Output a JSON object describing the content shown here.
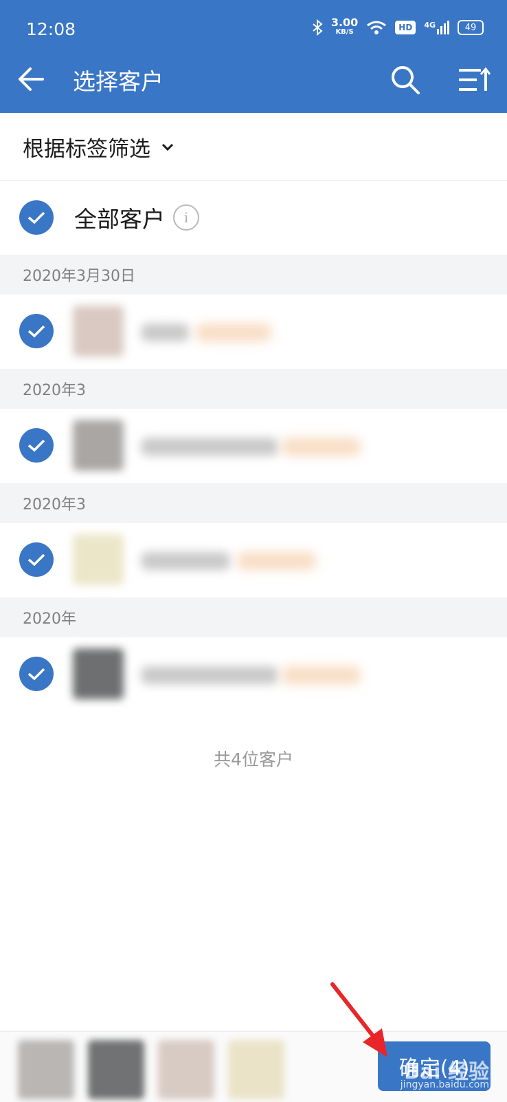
{
  "status_bar": {
    "time": "12:08",
    "speed_value": "3.00",
    "speed_unit": "KB/S",
    "hd": "HD",
    "network": "4G",
    "battery": "49"
  },
  "appbar": {
    "title": "选择客户",
    "back_icon": "arrow-left-icon",
    "search_icon": "search-icon",
    "sort_icon": "sort-list-icon"
  },
  "filter": {
    "label": "根据标签筛选"
  },
  "all_customers": {
    "label": "全部客户",
    "info": "i",
    "checked": true
  },
  "groups": [
    {
      "date": "2020年3月30日",
      "checked": true
    },
    {
      "date": "2020年3",
      "checked": true
    },
    {
      "date": "2020年3",
      "checked": true
    },
    {
      "date": "2020年",
      "checked": true
    }
  ],
  "total_text": "共4位客户",
  "confirm": {
    "label": "确定(4)"
  },
  "watermark": {
    "text": "Bai 经验",
    "url": "jingyan.baidu.com"
  },
  "colors": {
    "accent": "#3a76c6",
    "date_header_bg": "#f3f4f6",
    "annotation_arrow": "#e8262a"
  }
}
